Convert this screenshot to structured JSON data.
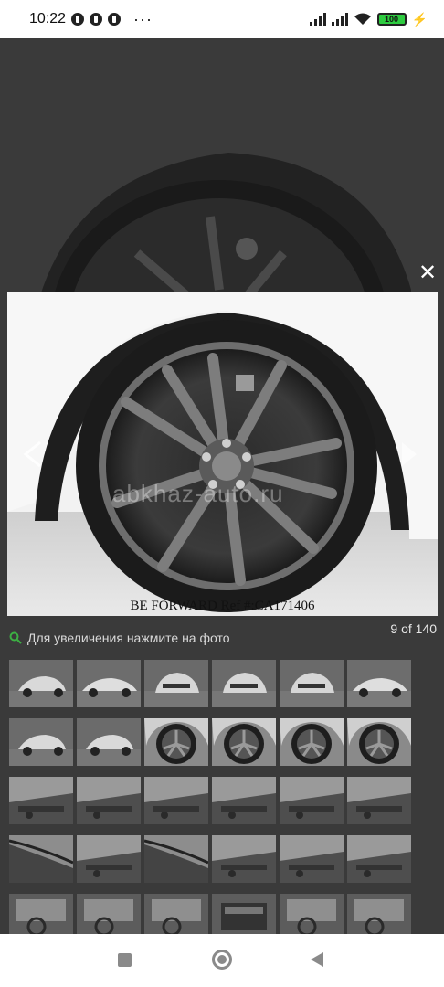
{
  "status_bar": {
    "time": "10:22",
    "notification_icons": [
      "facebook-icon",
      "messenger-icon",
      "facebook-icon"
    ],
    "more": "···",
    "battery": "100"
  },
  "viewer": {
    "close_label": "✕",
    "caption": "BE FORWARD Ref #:CA171406",
    "watermark": "abkhaz-auto.ru",
    "hint": "Для увеличения нажмите на фото",
    "counter": "9 of 140"
  },
  "thumbnails": {
    "rows": [
      [
        "car-front-white",
        "car-side-white",
        "car-rear-white",
        "car-rear-white",
        "car-rear-white",
        "car-side-white"
      ],
      [
        "car-front-white",
        "car-front-white",
        "wheel",
        "wheel",
        "wheel",
        "wheel"
      ],
      [
        "underbody",
        "underbody",
        "underbody",
        "underbody",
        "underbody",
        "underbody"
      ],
      [
        "fender",
        "underbody",
        "fender",
        "underbody",
        "underbody",
        "underbody"
      ],
      [
        "interior",
        "interior",
        "interior",
        "trunk",
        "interior",
        "interior"
      ]
    ]
  },
  "colors": {
    "overlay": "#3a3a3a",
    "accent_green": "#2ecc40"
  }
}
